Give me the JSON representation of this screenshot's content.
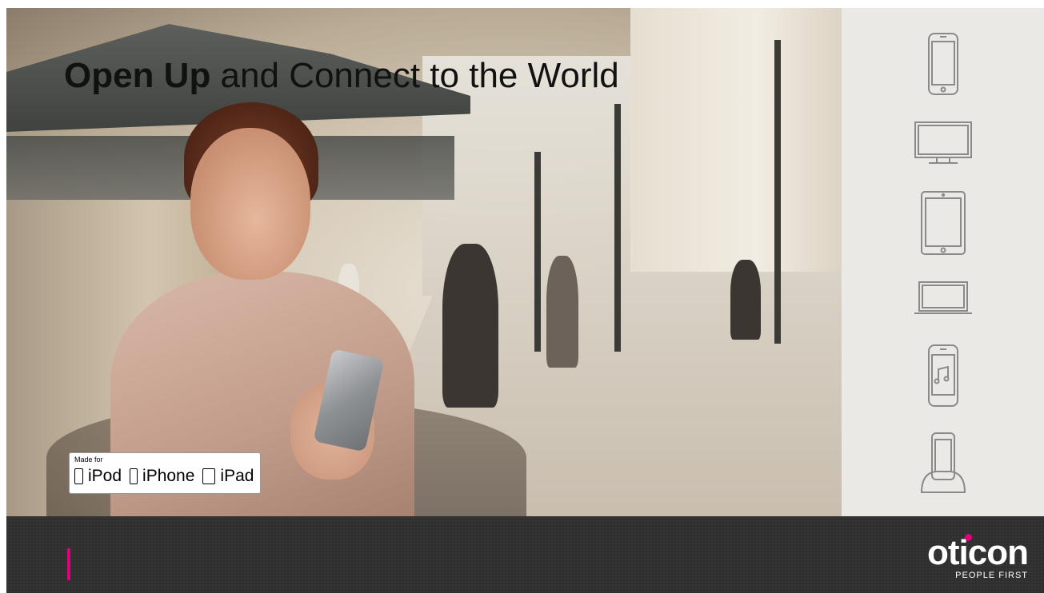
{
  "slide": {
    "title_bold": "Open Up",
    "title_rest": " and Connect to the World",
    "badge": {
      "made_for": "Made for",
      "items": [
        "iPod",
        "iPhone",
        "iPad"
      ]
    }
  },
  "device_panel": {
    "icons": [
      "smartphone-icon",
      "tv-monitor-icon",
      "tablet-icon",
      "laptop-icon",
      "music-player-icon",
      "phone-dock-icon"
    ]
  },
  "footer": {
    "logo_text": "oticon",
    "tagline": "PEOPLE FIRST",
    "accent_color": "#e3007d"
  }
}
